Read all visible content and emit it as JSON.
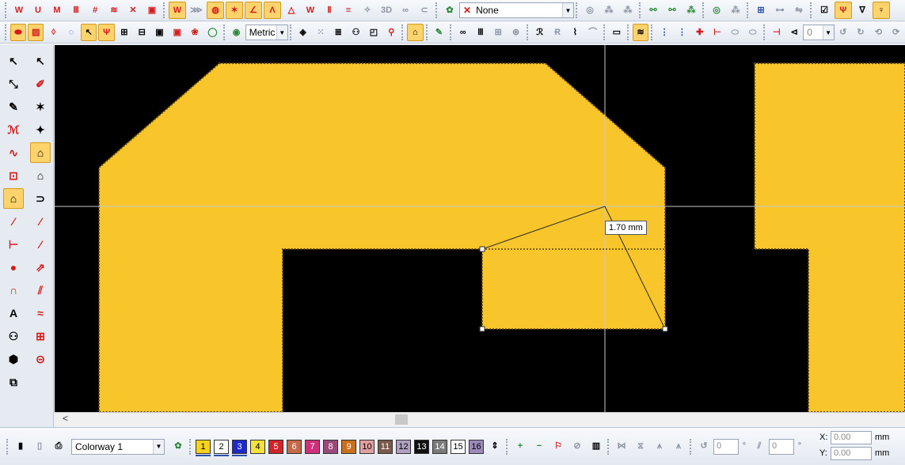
{
  "toolbar_top": {
    "view_3d_label": "3D",
    "thread_combo_value": "None"
  },
  "toolbar_second": {
    "units_combo_value": "Metric",
    "angle_value": "0"
  },
  "canvas": {
    "measure_tooltip": "1.70 mm"
  },
  "statusbar": {
    "colorway_value": "Colorway 1",
    "rotate_angle_value": "0",
    "slant_angle_value": "0",
    "coord_x_label": "X:",
    "coord_y_label": "Y:",
    "coord_x_value": "0.00",
    "coord_y_value": "0.00",
    "coord_unit": "mm",
    "swatches": [
      {
        "label": "1",
        "color": "#f7d21a",
        "text": "#000"
      },
      {
        "label": "2",
        "color": "#ffffff",
        "text": "#000"
      },
      {
        "label": "3",
        "color": "#1d28c9",
        "text": "#fff"
      },
      {
        "label": "4",
        "color": "#f5e23a",
        "text": "#000"
      },
      {
        "label": "5",
        "color": "#d0242a",
        "text": "#fff"
      },
      {
        "label": "6",
        "color": "#c46a48",
        "text": "#fff"
      },
      {
        "label": "7",
        "color": "#d0307a",
        "text": "#fff"
      },
      {
        "label": "8",
        "color": "#9a4a7a",
        "text": "#fff"
      },
      {
        "label": "9",
        "color": "#c8701e",
        "text": "#fff"
      },
      {
        "label": "10",
        "color": "#e0a0a0",
        "text": "#000"
      },
      {
        "label": "11",
        "color": "#7a5a4a",
        "text": "#fff"
      },
      {
        "label": "12",
        "color": "#b0a0c0",
        "text": "#000"
      },
      {
        "label": "13",
        "color": "#101010",
        "text": "#fff"
      },
      {
        "label": "14",
        "color": "#7a7a7a",
        "text": "#fff"
      },
      {
        "label": "15",
        "color": "#ffffff",
        "text": "#000"
      },
      {
        "label": "16",
        "color": "#9a8ab8",
        "text": "#000"
      }
    ]
  },
  "colors": {
    "fill": "#f8c52a",
    "canvas_bg": "#000000",
    "active_tool": "#ffd36b"
  }
}
